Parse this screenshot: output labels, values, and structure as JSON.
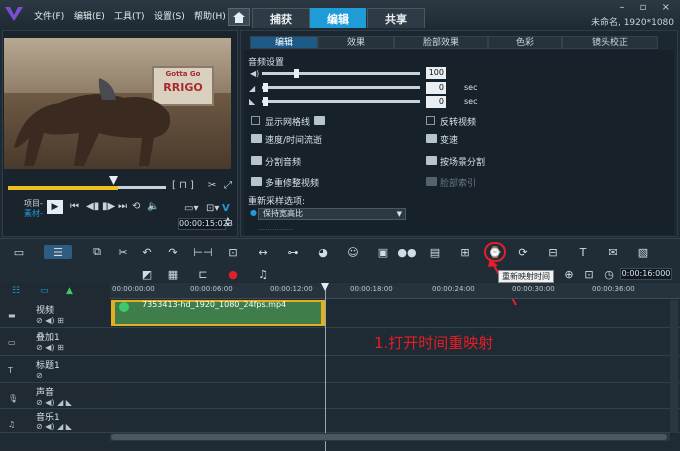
{
  "menu": {
    "file": "文件(F)",
    "edit": "编辑(E)",
    "tools": "工具(T)",
    "settings": "设置(S)",
    "help": "帮助(H)"
  },
  "top_tabs": {
    "capture": "捕获",
    "edit": "编辑",
    "share": "共享"
  },
  "project_info": "未命名, 1920*1080",
  "window_controls": "– ▫ ×",
  "player": {
    "mode_project": "项目-",
    "mode_clip": "素材-",
    "timecode": "00:00:15:023",
    "tc_up": "▲",
    "tc_down": "▼",
    "vbtn": "V",
    "sign_line1": "Gotta Go",
    "sign_line2": "RRIGO"
  },
  "options_tabs": {
    "edit": "编辑",
    "effect": "效果",
    "face": "脸部效果",
    "color": "色彩",
    "lens": "镜头校正"
  },
  "options": {
    "audio_settings": "音频设置",
    "volume_value": "100",
    "fadein_value": "0",
    "fadeout_value": "0",
    "sec": "sec",
    "show_grid": "显示网格线",
    "reverse_video": "反转视频",
    "speed_timelapse": "速度/时间流逝",
    "speed": "变速",
    "split_audio": "分割音频",
    "split_by_scene": "按场景分割",
    "multi_trim": "多重修整视频",
    "face_index": "脸部索引",
    "resample_options": "重新采样选项:",
    "keep_ratio": "保持宽高比",
    "truncated": "……………"
  },
  "tooltip": "重新映射时间",
  "annotation": "1.打开时间重映射",
  "timecode_right": "0:00:16:000",
  "ruler_ticks": [
    "00:00:00:00",
    "00:00:06:00",
    "00:00:12:00",
    "00:00:18:00",
    "00:00:24:00",
    "00:00:30:00",
    "00:00:36:00"
  ],
  "tracks": {
    "video": "视频",
    "overlay": "叠加1",
    "title": "标题1",
    "voice": "声音",
    "music": "音乐1"
  },
  "clip_name": "7353413-hd_1920_1080_24fps.mp4",
  "colors": {
    "accent": "#1f9bd8",
    "highlight": "#e0202a",
    "clip": "#3f7e4a",
    "clip_border": "#e0b020"
  }
}
